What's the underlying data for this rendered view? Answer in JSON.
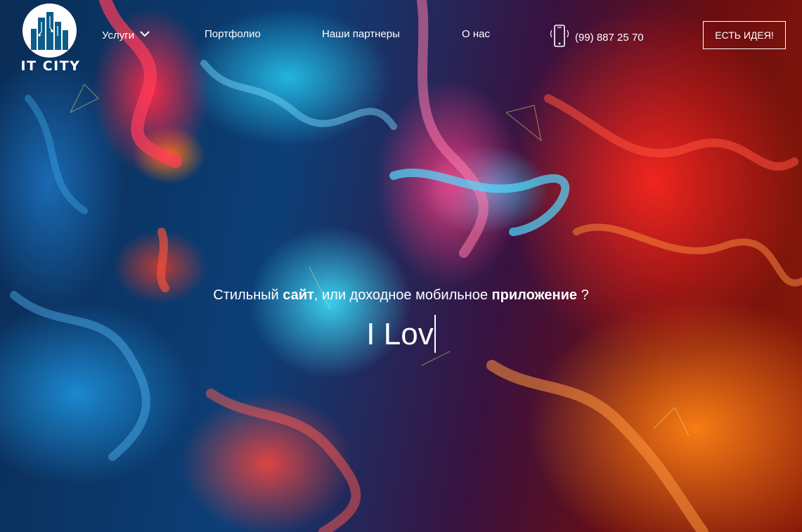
{
  "brand": {
    "name": "IT CITY",
    "logo_icon": "city-buildings-icon"
  },
  "nav": {
    "items": [
      {
        "label": "Услуги",
        "has_dropdown": true
      },
      {
        "label": "Портфолио"
      },
      {
        "label": "Наши партнеры"
      },
      {
        "label": "О нас"
      }
    ],
    "phone": {
      "icon": "mobile-phone-icon",
      "number": "(99) 887 25 70"
    },
    "cta_label": "ЕСТЬ ИДЕЯ!"
  },
  "hero": {
    "tagline": {
      "part1": "Стильный ",
      "bold1": "сайт",
      "part2": ", или доходное мобильное ",
      "bold2": "приложение",
      "part3": " ?"
    },
    "typed_text": "I Lov"
  },
  "colors": {
    "text": "#ffffff",
    "cta_border": "#ffffff"
  }
}
